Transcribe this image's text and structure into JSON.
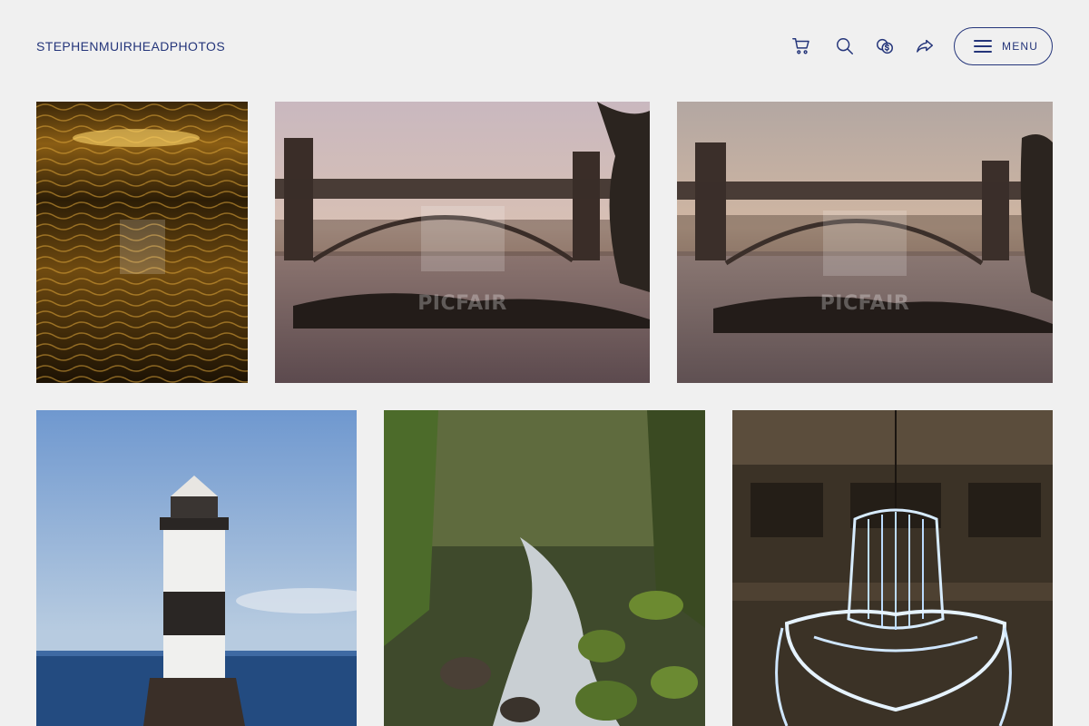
{
  "site": {
    "brand": "STEPHENMUIRHEADPHOTOS"
  },
  "header": {
    "icons": [
      "cart-icon",
      "search-icon",
      "currency-icon",
      "share-icon"
    ],
    "menu_label": "MENU",
    "accent": "#24357a"
  },
  "gallery": {
    "watermark": "PICFAIR",
    "photos": [
      {
        "subject": "sunlit-water"
      },
      {
        "subject": "bridge-sunset-1"
      },
      {
        "subject": "bridge-sunset-2"
      },
      {
        "subject": "lighthouse"
      },
      {
        "subject": "woodland-stream"
      },
      {
        "subject": "chandelier"
      }
    ]
  }
}
